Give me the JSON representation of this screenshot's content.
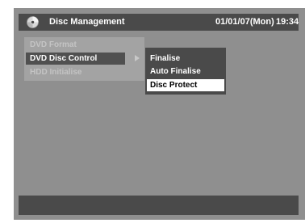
{
  "header": {
    "icon": "disc-icon",
    "title": "Disc Management",
    "date": "01/01/07(Mon)",
    "time": "19:34"
  },
  "main_menu": {
    "items": [
      {
        "label": "DVD Format",
        "state": "dim"
      },
      {
        "label": "DVD Disc Control",
        "state": "active"
      },
      {
        "label": "HDD Initialise",
        "state": "dim"
      }
    ],
    "arrow_icon": "triangle-right-icon"
  },
  "submenu": {
    "items": [
      {
        "label": "Finalise",
        "selected": false
      },
      {
        "label": "Auto Finalise",
        "selected": false
      },
      {
        "label": "Disc Protect",
        "selected": true
      }
    ]
  },
  "colors": {
    "screen_background": "#8f8f8f",
    "bar_background": "#4a4a4a",
    "active_item": "#505050",
    "highlight": "#ffffff"
  }
}
